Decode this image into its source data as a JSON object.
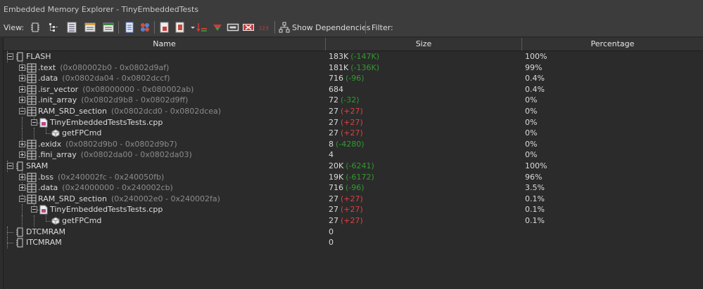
{
  "window": {
    "title": "Embedded Memory Explorer - TinyEmbeddedTests"
  },
  "toolbar": {
    "view_label": "View:",
    "show_deps_label": "Show Dependencies",
    "filter_label": "Filter:",
    "buttons": [
      {
        "icon": "memory-view-icon"
      },
      {
        "icon": "tree-view-icon"
      },
      {
        "icon": "list-view-icon"
      },
      {
        "icon": "section-view-icon"
      },
      {
        "icon": "symbol-view-icon"
      },
      {
        "icon": "document-icon"
      },
      {
        "icon": "group-icon"
      },
      {
        "icon": "export-icon"
      },
      {
        "icon": "export-dropdown-icon"
      },
      {
        "icon": "sort-icon"
      },
      {
        "icon": "highlight-icon"
      },
      {
        "icon": "frame-icon"
      },
      {
        "icon": "clear-icon"
      },
      {
        "icon": "numbers-icon"
      },
      {
        "icon": "dependencies-icon"
      }
    ]
  },
  "table": {
    "columns": [
      "Name",
      "Size",
      "Percentage"
    ],
    "rows": [
      {
        "name": "FLASH",
        "addr": "",
        "size": "183K",
        "delta": "(-147K)",
        "delta_sign": "neg",
        "pct": "100%",
        "level": 0,
        "icon": "memory-region-icon",
        "exp": "minus"
      },
      {
        "name": ".text",
        "addr": "(0x080002b0 - 0x0802d9af)",
        "size": "181K",
        "delta": "(-136K)",
        "delta_sign": "neg",
        "pct": "99%",
        "level": 1,
        "icon": "section-icon",
        "exp": "plus"
      },
      {
        "name": ".data",
        "addr": "(0x0802da04 - 0x0802dccf)",
        "size": "716",
        "delta": "(-96)",
        "delta_sign": "neg",
        "pct": "0.4%",
        "level": 1,
        "icon": "section-icon",
        "exp": "plus"
      },
      {
        "name": ".isr_vector",
        "addr": "(0x08000000 - 0x080002ab)",
        "size": "684",
        "delta": "",
        "delta_sign": "",
        "pct": "0.4%",
        "level": 1,
        "icon": "section-icon",
        "exp": "plus"
      },
      {
        "name": ".init_array",
        "addr": "(0x0802d9b8 - 0x0802d9ff)",
        "size": "72",
        "delta": "(-32)",
        "delta_sign": "neg",
        "pct": "0%",
        "level": 1,
        "icon": "section-icon",
        "exp": "plus"
      },
      {
        "name": "RAM_SRD_section",
        "addr": "(0x0802dcd0 - 0x0802dcea)",
        "size": "27",
        "delta": "(+27)",
        "delta_sign": "pos",
        "pct": "0%",
        "level": 1,
        "icon": "section-icon",
        "exp": "minus"
      },
      {
        "name": "TinyEmbeddedTestsTests.cpp",
        "addr": "",
        "size": "27",
        "delta": "(+27)",
        "delta_sign": "pos",
        "pct": "0%",
        "level": 2,
        "icon": "source-file-icon",
        "exp": "minus"
      },
      {
        "name": "getFPCmd",
        "addr": "",
        "size": "27",
        "delta": "(+27)",
        "delta_sign": "pos",
        "pct": "0%",
        "level": 3,
        "icon": "function-icon",
        "exp": ""
      },
      {
        "name": ".exidx",
        "addr": "(0x0802d9b0 - 0x0802d9b7)",
        "size": "8",
        "delta": "(-4280)",
        "delta_sign": "neg",
        "pct": "0%",
        "level": 1,
        "icon": "section-icon",
        "exp": "plus"
      },
      {
        "name": ".fini_array",
        "addr": "(0x0802da00 - 0x0802da03)",
        "size": "4",
        "delta": "",
        "delta_sign": "",
        "pct": "0%",
        "level": 1,
        "icon": "section-icon",
        "exp": "plus"
      },
      {
        "name": "SRAM",
        "addr": "",
        "size": "20K",
        "delta": "(-6241)",
        "delta_sign": "neg",
        "pct": "100%",
        "level": 0,
        "icon": "memory-region-icon",
        "exp": "minus"
      },
      {
        "name": ".bss",
        "addr": "(0x240002fc - 0x240050fb)",
        "size": "19K",
        "delta": "(-6172)",
        "delta_sign": "neg",
        "pct": "96%",
        "level": 1,
        "icon": "section-icon",
        "exp": "plus"
      },
      {
        "name": ".data",
        "addr": "(0x24000000 - 0x240002cb)",
        "size": "716",
        "delta": "(-96)",
        "delta_sign": "neg",
        "pct": "3.5%",
        "level": 1,
        "icon": "section-icon",
        "exp": "plus"
      },
      {
        "name": "RAM_SRD_section",
        "addr": "(0x240002e0 - 0x240002fa)",
        "size": "27",
        "delta": "(+27)",
        "delta_sign": "pos",
        "pct": "0.1%",
        "level": 1,
        "icon": "section-icon",
        "exp": "minus"
      },
      {
        "name": "TinyEmbeddedTestsTests.cpp",
        "addr": "",
        "size": "27",
        "delta": "(+27)",
        "delta_sign": "pos",
        "pct": "0.1%",
        "level": 2,
        "icon": "source-file-icon",
        "exp": "minus"
      },
      {
        "name": "getFPCmd",
        "addr": "",
        "size": "27",
        "delta": "(+27)",
        "delta_sign": "pos",
        "pct": "0.1%",
        "level": 3,
        "icon": "function-icon",
        "exp": ""
      },
      {
        "name": "DTCMRAM",
        "addr": "",
        "size": "0",
        "delta": "",
        "delta_sign": "",
        "pct": "",
        "level": 0,
        "icon": "memory-region-icon",
        "exp": ""
      },
      {
        "name": "ITCMRAM",
        "addr": "",
        "size": "0",
        "delta": "",
        "delta_sign": "",
        "pct": "",
        "level": 0,
        "icon": "memory-region-icon",
        "exp": ""
      }
    ]
  },
  "colors": {
    "delta_negative": "#2f9b2f",
    "delta_positive": "#e04040",
    "address": "#8c8c8c"
  }
}
